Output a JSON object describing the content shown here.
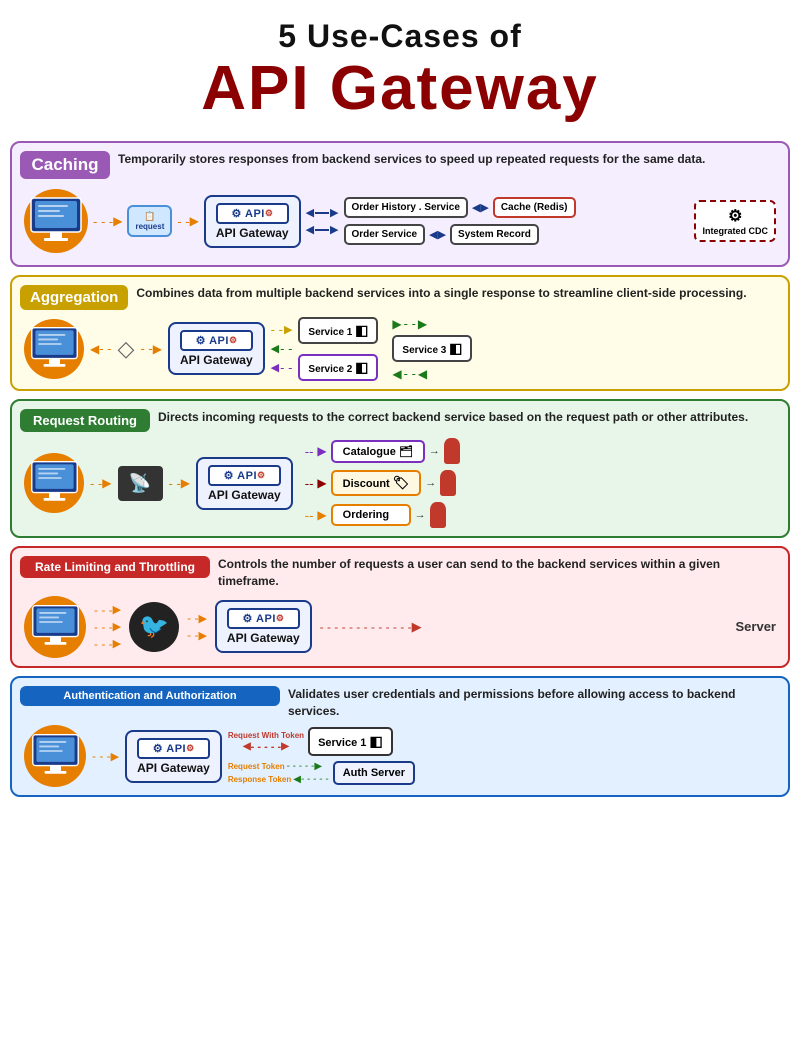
{
  "title": {
    "line1": "5 Use-Cases of",
    "line2": "API Gateway"
  },
  "sections": {
    "caching": {
      "tag": "Caching",
      "desc": "Temporarily stores responses from backend services to speed up repeated requests for the same data.",
      "nodes": {
        "api_gateway": "API Gateway",
        "order_history": "Order History . Service",
        "cache": "Cache (Redis)",
        "order_service": "Order Service",
        "system_record": "System Record",
        "integrated": "Integrated CDC"
      }
    },
    "aggregation": {
      "tag": "Aggregation",
      "desc": "Combines data from multiple backend services into a single response to streamline client-side processing.",
      "nodes": {
        "api_gateway": "API Gateway",
        "service1": "Service 1",
        "service2": "Service 2",
        "service3": "Service 3"
      }
    },
    "routing": {
      "tag": "Request Routing",
      "desc": "Directs incoming requests to the correct backend service based on the request path or other attributes.",
      "nodes": {
        "api_gateway": "API Gateway",
        "catalogue": "Catalogue",
        "discount": "Discount",
        "ordering": "Ordering"
      }
    },
    "rate": {
      "tag": "Rate Limiting and Throttling",
      "desc": "Controls the number of requests a user can send to the backend services within a given timeframe.",
      "nodes": {
        "api_gateway": "API Gateway",
        "server": "Server"
      }
    },
    "auth": {
      "tag": "Authentication and Authorization",
      "desc": "Validates user credentials and permissions before allowing access to backend services.",
      "nodes": {
        "api_gateway": "API Gateway",
        "service1": "Service 1",
        "auth_server": "Auth Server",
        "request_token_label": "Request With Token",
        "request_token": "Request Token",
        "response_token": "Response Token"
      }
    }
  }
}
